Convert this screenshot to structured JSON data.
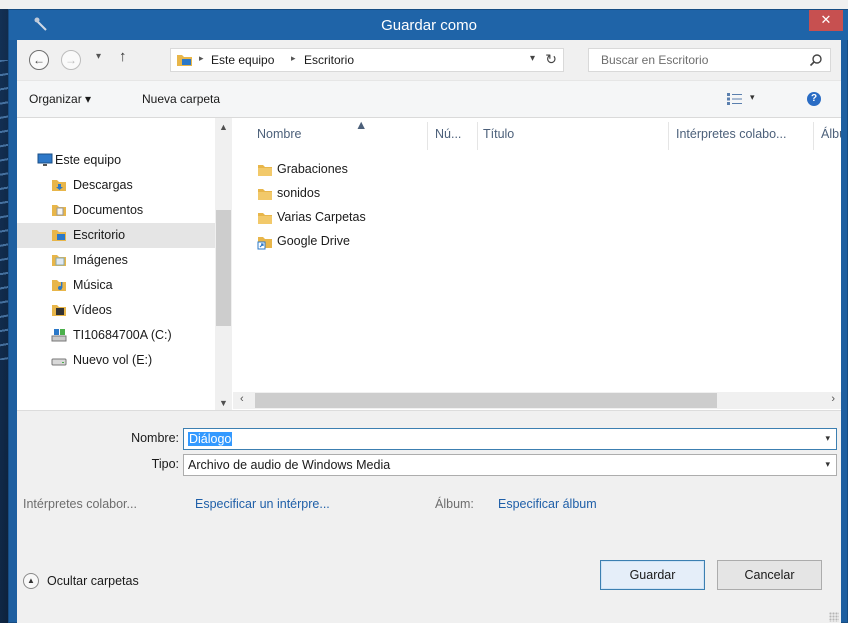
{
  "window": {
    "title": "Guardar como",
    "close_glyph": "✕"
  },
  "nav": {
    "back_glyph": "←",
    "forward_glyph": "→",
    "recent_glyph": "▾",
    "up_glyph": "↑",
    "address": [
      "Este equipo",
      "Escritorio"
    ],
    "address_sep": "▸",
    "address_dropdown_glyph": "▾",
    "refresh_glyph": "↻",
    "search_placeholder": "Buscar en Escritorio"
  },
  "toolbar": {
    "organize_label": "Organizar ▾",
    "new_folder_label": "Nueva carpeta",
    "views_arrow": "▾",
    "help_glyph": "?"
  },
  "sidebar": {
    "items": [
      {
        "label": "Este equipo",
        "icon": "computer-icon"
      },
      {
        "label": "Descargas",
        "icon": "downloads-folder-icon"
      },
      {
        "label": "Documentos",
        "icon": "documents-folder-icon"
      },
      {
        "label": "Escritorio",
        "icon": "desktop-folder-icon",
        "selected": true
      },
      {
        "label": "Imágenes",
        "icon": "pictures-folder-icon"
      },
      {
        "label": "Música",
        "icon": "music-folder-icon"
      },
      {
        "label": "Vídeos",
        "icon": "videos-folder-icon"
      },
      {
        "label": "TI10684700A (C:)",
        "icon": "drive-c-icon"
      },
      {
        "label": "Nuevo vol (E:)",
        "icon": "drive-e-icon"
      }
    ],
    "scroll_up": "▲",
    "scroll_down": "▼"
  },
  "columns": [
    "Nombre",
    "Nú...",
    "Título",
    "Intérpretes colabo...",
    "Álbu"
  ],
  "sort_glyph": "▲",
  "files": [
    {
      "name": "Grabaciones",
      "icon": "folder-icon"
    },
    {
      "name": "sonidos",
      "icon": "folder-icon"
    },
    {
      "name": "Varias Carpetas",
      "icon": "folder-icon"
    },
    {
      "name": "Google Drive",
      "icon": "shortcut-folder-icon"
    }
  ],
  "hscroll": {
    "left": "‹",
    "right": "›"
  },
  "form": {
    "name_label": "Nombre:",
    "name_value": "Diálogo",
    "type_label": "Tipo:",
    "type_value": "Archivo de audio de Windows Media",
    "dropdown_glyph": "▾",
    "artists_label": "Intérpretes colabor...",
    "artists_link": "Especificar un intérpre...",
    "album_label": "Álbum:",
    "album_link": "Especificar álbum"
  },
  "footer": {
    "hide_folders_label": "Ocultar carpetas",
    "hide_glyph": "▲",
    "save_label": "Guardar",
    "cancel_label": "Cancelar"
  },
  "colors": {
    "titlebar": "#1f64a8",
    "close": "#c75050",
    "link": "#1f5fa8",
    "selection": "#3399ff",
    "folder": "#e8b64a"
  }
}
